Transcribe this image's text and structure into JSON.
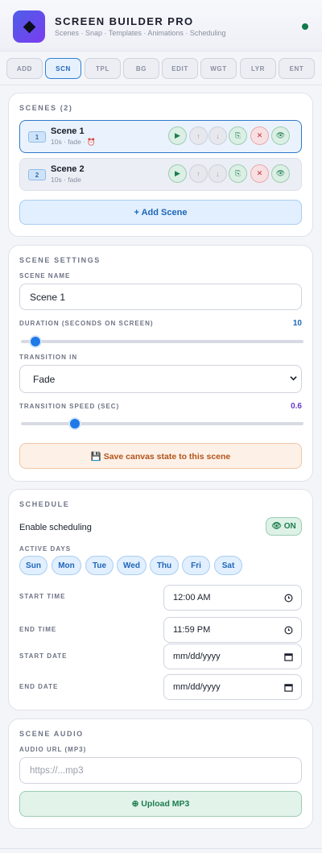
{
  "header": {
    "title": "SCREEN BUILDER PRO",
    "subtitle": "Scenes · Snap · Templates · Animations · Scheduling",
    "logo_icon": "diamond-icon",
    "status_color": "#0f7a4c"
  },
  "tabs": [
    {
      "label": "ADD",
      "active": false
    },
    {
      "label": "SCN",
      "active": true
    },
    {
      "label": "TPL",
      "active": false
    },
    {
      "label": "BG",
      "active": false
    },
    {
      "label": "EDIT",
      "active": false
    },
    {
      "label": "WGT",
      "active": false
    },
    {
      "label": "LYR",
      "active": false
    },
    {
      "label": "ENT",
      "active": false
    }
  ],
  "scenes": {
    "title": "SCENES (2)",
    "items": [
      {
        "number": "1",
        "name": "Scene 1",
        "meta": "10s · fade · ⏰",
        "selected": true
      },
      {
        "number": "2",
        "name": "Scene 2",
        "meta": "10s · fade",
        "selected": false
      }
    ],
    "row_actions": [
      "play-icon",
      "arrow-up-icon",
      "arrow-down-icon",
      "copy-icon",
      "delete-icon",
      "eye-icon"
    ],
    "add_label": "+ Add Scene"
  },
  "settings": {
    "title": "SCENE SETTINGS",
    "name_label": "SCENE NAME",
    "name_value": "Scene 1",
    "duration_label": "DURATION (SECONDS ON SCREEN)",
    "duration_value": "10",
    "duration_fraction": 0.05,
    "transition_label": "TRANSITION IN",
    "transition_value": "Fade",
    "speed_label": "TRANSITION SPEED (SEC)",
    "speed_value": "0.6",
    "speed_fraction": 0.19,
    "save_label": "💾 Save canvas state to this scene"
  },
  "schedule": {
    "title": "SCHEDULE",
    "enable_label": "Enable scheduling",
    "toggle_label": "👁 ON",
    "days_label": "ACTIVE DAYS",
    "days": [
      "Sun",
      "Mon",
      "Tue",
      "Wed",
      "Thu",
      "Fri",
      "Sat"
    ],
    "start_time_label": "START TIME",
    "start_time_value": "12:00 AM",
    "end_time_label": "END TIME",
    "end_time_value": "11:59 PM",
    "start_date_label": "START DATE",
    "start_date_placeholder": "mm/dd/yyyy",
    "end_date_label": "END DATE",
    "end_date_placeholder": "mm/dd/yyyy"
  },
  "audio": {
    "title": "SCENE AUDIO",
    "url_label": "AUDIO URL (MP3)",
    "url_placeholder": "https://...mp3",
    "upload_label": "⊕ Upload MP3"
  }
}
